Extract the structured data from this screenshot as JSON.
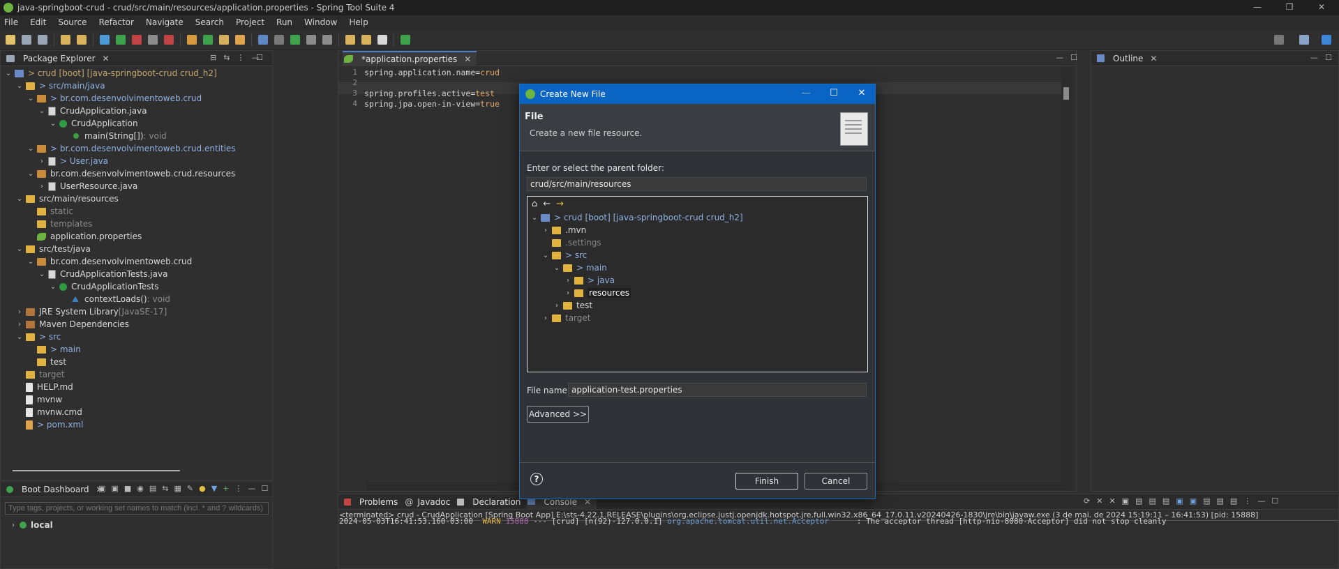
{
  "window": {
    "title": "java-springboot-crud - crud/src/main/resources/application.properties - Spring Tool Suite 4",
    "controls": [
      "—",
      "❐",
      "✕"
    ]
  },
  "menu": [
    "File",
    "Edit",
    "Source",
    "Refactor",
    "Navigate",
    "Search",
    "Project",
    "Run",
    "Window",
    "Help"
  ],
  "package_explorer": {
    "tab": "Package Explorer",
    "items": [
      {
        "label": "> crud [boot] [java-springboot-crud crud_h2]",
        "icon": "project-icon"
      },
      {
        "label": "> src/main/java",
        "icon": "folder-icon"
      },
      {
        "label": "> br.com.desenvolvimentoweb.crud",
        "icon": "package-icon"
      },
      {
        "label": "CrudApplication.java",
        "icon": "java-file-icon"
      },
      {
        "label": "CrudApplication",
        "icon": "class-icon"
      },
      {
        "label": "main(String[])",
        "suffix": " : void",
        "icon": "method-icon"
      },
      {
        "label": "> br.com.desenvolvimentoweb.crud.entities",
        "icon": "package-icon"
      },
      {
        "label": "> User.java",
        "icon": "java-file-icon"
      },
      {
        "label": "br.com.desenvolvimentoweb.crud.resources",
        "icon": "package-icon"
      },
      {
        "label": "UserResource.java",
        "icon": "java-file-icon"
      },
      {
        "label": "src/main/resources",
        "icon": "folder-icon"
      },
      {
        "label": "static",
        "icon": "folder-icon"
      },
      {
        "label": "templates",
        "icon": "folder-icon"
      },
      {
        "label": "application.properties",
        "icon": "spring-leaf-icon"
      },
      {
        "label": "src/test/java",
        "icon": "folder-icon"
      },
      {
        "label": "br.com.desenvolvimentoweb.crud",
        "icon": "package-icon"
      },
      {
        "label": "CrudApplicationTests.java",
        "icon": "java-file-icon"
      },
      {
        "label": "CrudApplicationTests",
        "icon": "class-icon"
      },
      {
        "label": "contextLoads()",
        "suffix": " : void",
        "icon": "method-icon"
      },
      {
        "label": "JRE System Library",
        "suffix": " [JavaSE-17]",
        "icon": "library-icon"
      },
      {
        "label": "Maven Dependencies",
        "icon": "library-icon"
      },
      {
        "label": "> src",
        "icon": "folder-icon"
      },
      {
        "label": "> main",
        "icon": "folder-icon"
      },
      {
        "label": "test",
        "icon": "folder-icon"
      },
      {
        "label": "target",
        "icon": "folder-icon"
      },
      {
        "label": "HELP.md",
        "icon": "file-icon"
      },
      {
        "label": "mvnw",
        "icon": "file-icon"
      },
      {
        "label": "mvnw.cmd",
        "icon": "file-icon"
      },
      {
        "label": "> pom.xml",
        "icon": "file-icon"
      }
    ]
  },
  "boot_dashboard": {
    "tab": "Boot Dashboard",
    "filter_placeholder": "Type tags, projects, or working set names to match (incl. * and ? wildcards)",
    "items": [
      "local"
    ]
  },
  "editor": {
    "tab": "*application.properties",
    "lines": [
      {
        "n": "1",
        "key": "spring.application.name=",
        "value": "crud"
      },
      {
        "n": "2",
        "key": "",
        "value": ""
      },
      {
        "n": "3",
        "key": "spring.profiles.active=",
        "value": "test"
      },
      {
        "n": "4",
        "key": "spring.jpa.open-in-view=",
        "value": "true"
      }
    ]
  },
  "outline": {
    "tab": "Outline"
  },
  "dialog": {
    "title": "Create New File",
    "heading": "File",
    "subheading": "Create a new file resource.",
    "parent_label": "Enter or select the parent folder:",
    "parent_value": "crud/src/main/resources",
    "tree": [
      {
        "label": "> crud [boot] [java-springboot-crud crud_h2]"
      },
      {
        "label": ".mvn"
      },
      {
        "label": ".settings"
      },
      {
        "label": "> src"
      },
      {
        "label": "> main"
      },
      {
        "label": "> java"
      },
      {
        "label": "resources"
      },
      {
        "label": "test"
      },
      {
        "label": "target"
      }
    ],
    "filename_label": "File name:",
    "filename_value": "application-test.properties",
    "advanced": "Advanced >>",
    "finish": "Finish",
    "cancel": "Cancel",
    "help": "?"
  },
  "bottom": {
    "tabs": [
      "Problems",
      "Javadoc",
      "Declaration",
      "Console"
    ],
    "terminated": "<terminated> crud - CrudApplication [Spring Boot App] E:\\sts-4.22.1.RELEASE\\plugins\\org.eclipse.justj.openjdk.hotspot.jre.full.win32.x86_64_17.0.11.v20240426-1830\\jre\\bin\\javaw.exe  (3 de mai. de 2024 15:19:11 – 16:41:53) [pid: 15888]",
    "log": {
      "timestamp": "2024-05-03T16:41:53.160-03:00",
      "level": "WARN",
      "pid": "15888",
      "mid": "--- [crud] [n(92)-127.0.0.1]",
      "logger": "org.apache.tomcat.util.net.Acceptor",
      "message": ": The acceptor thread [http-nio-8080-Acceptor] did not stop cleanly"
    }
  },
  "colors": {
    "accent": "#0a64c4",
    "spring": "#6db33f",
    "warn": "#e6b94b"
  }
}
